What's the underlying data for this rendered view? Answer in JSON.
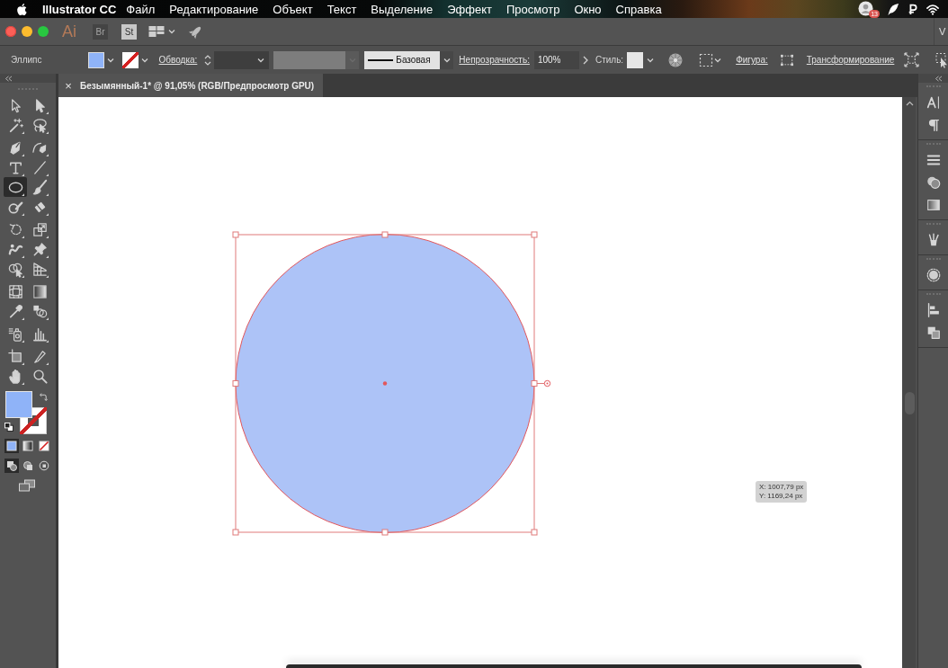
{
  "menu_bar": {
    "app_name": "Illustrator CC",
    "items": [
      "Файл",
      "Редактирование",
      "Объект",
      "Текст",
      "Выделение",
      "Эффект",
      "Просмотр",
      "Окно",
      "Справка"
    ],
    "status_badge": "13"
  },
  "app_bar": {
    "logo": "Ai",
    "apps": [
      {
        "label": "Br",
        "disabled": true
      },
      {
        "label": "St",
        "disabled": false
      }
    ],
    "workspace": "V"
  },
  "control_bar": {
    "selection_type": "Эллипс",
    "stroke_label": "Обводка:",
    "width_profile": {
      "disabled": true
    },
    "stroke_style": "Базовая",
    "opacity_label": "Непрозрачность:",
    "opacity": "100%",
    "style_label": "Стиль:",
    "shape_label": "Фигура:",
    "transform_label": "Трансформирование"
  },
  "document_tab": {
    "close": "×",
    "title": "Безымянный-1* @ 91,05% (RGB/Предпросмотр GPU)"
  },
  "tool_groups": [
    [
      {
        "kind": "select",
        "selected": false
      },
      {
        "kind": "direct",
        "selected": false
      },
      {
        "kind": "wand",
        "selected": false
      },
      {
        "kind": "lasso",
        "selected": false
      }
    ],
    [
      {
        "kind": "pen",
        "selected": false
      },
      {
        "kind": "curvature",
        "selected": false
      },
      {
        "kind": "type",
        "selected": false
      },
      {
        "kind": "line",
        "selected": false
      },
      {
        "kind": "ellipse",
        "selected": true
      },
      {
        "kind": "brush",
        "selected": false
      },
      {
        "kind": "shaper",
        "selected": false
      },
      {
        "kind": "eraser",
        "selected": false
      }
    ],
    [
      {
        "kind": "rotate",
        "selected": false
      },
      {
        "kind": "scale",
        "selected": false
      },
      {
        "kind": "warp",
        "selected": false
      },
      {
        "kind": "pin",
        "selected": false
      },
      {
        "kind": "builder",
        "selected": false
      },
      {
        "kind": "perspective",
        "selected": false
      }
    ],
    [
      {
        "kind": "mesh",
        "selected": false
      },
      {
        "kind": "gradient",
        "selected": false
      },
      {
        "kind": "eyedropper",
        "selected": false
      },
      {
        "kind": "blend",
        "selected": false
      }
    ],
    [
      {
        "kind": "sprayer",
        "selected": false
      },
      {
        "kind": "graph",
        "selected": false
      }
    ],
    [
      {
        "kind": "artboard",
        "selected": false
      },
      {
        "kind": "knife",
        "selected": false
      },
      {
        "kind": "hand",
        "selected": false
      },
      {
        "kind": "zoom",
        "selected": false
      }
    ]
  ],
  "color_modes": [
    {
      "kind": "color",
      "selected": true
    },
    {
      "kind": "gradient",
      "selected": false
    },
    {
      "kind": "none",
      "selected": false
    }
  ],
  "draw_modes": [
    {
      "kind": "normal",
      "selected": true
    },
    {
      "kind": "behind",
      "selected": false
    },
    {
      "kind": "inside",
      "selected": false
    }
  ],
  "canvas": {
    "shape": {
      "kind": "ellipse",
      "selected": true
    },
    "cursor_tooltip": [
      "X: 1007,79 px",
      "Y: 1169,24 px"
    ]
  },
  "panel_groups": [
    [
      {
        "kind": "character"
      },
      {
        "kind": "paragraph"
      }
    ],
    [
      {
        "kind": "stroke"
      },
      {
        "kind": "transparency"
      },
      {
        "kind": "gradient"
      }
    ],
    [
      {
        "kind": "brushes"
      }
    ],
    [
      {
        "kind": "symbols"
      }
    ],
    [
      {
        "kind": "align"
      },
      {
        "kind": "pathfinder"
      }
    ]
  ]
}
